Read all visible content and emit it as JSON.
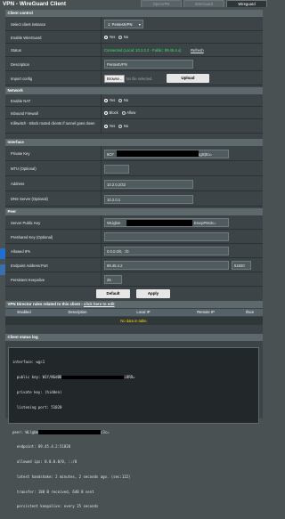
{
  "window": {
    "title": "VPN - WireGuard Client",
    "tabs": [
      "OpenVPN",
      "WireGuard",
      "Wireguard"
    ]
  },
  "sections": {
    "client_control": "Client control",
    "network": "Network",
    "interface": "Interface",
    "peer": "Peer",
    "director": "VPN Director rules related to this client - ",
    "director_link": "click here to edit",
    "status_log": "Client status log"
  },
  "client_control": {
    "instance_label": "Select client instance",
    "instance_value": "1: PentestVPN",
    "enable_label": "Enable WireGuard",
    "yes": "Yes",
    "no": "No",
    "status_label": "Status",
    "status_value": "Connected (Local: 10.2.0.2 - Public: 89.45.4.x)",
    "refresh": "Refresh",
    "desc_label": "Description",
    "desc_value": "PentestVPN",
    "import_label": "Import config",
    "browse": "Browse...",
    "no_file": "No file selected.",
    "upload": "Upload"
  },
  "network": {
    "nat_label": "Enable NAT",
    "firewall_label": "Inbound Firewall",
    "block": "Block",
    "allow": "Allow",
    "killswitch_label": "Killswitch - Block routed clients if tunnel goes down"
  },
  "interface": {
    "privkey_label": "Private Key",
    "privkey_prefix": "8CF",
    "privkey_suffix": "5gS|Eo=",
    "mtu_label": "MTU (Optional)",
    "mtu_value": "",
    "address_label": "Address",
    "address_value": "10.2.0.2/32",
    "dns_label": "DNS Server (Optional)",
    "dns_value": "10.2.0.1"
  },
  "peer": {
    "pubkey_label": "Server Public Key",
    "pubkey_prefix": "WLlgbm",
    "pubkey_suffix": "EIxcpP6s3c=",
    "psk_label": "Preshared Key (Optional)",
    "psk_value": "",
    "allowed_label": "Allowed IPs",
    "allowed_value": "0.0.0.0/0, ::/0",
    "endpoint_label": "Endpoint Address:Port",
    "endpoint_value": "89.45.4.2",
    "endpoint_port": "51820",
    "keepalive_label": "Persistent Keepalive",
    "keepalive_value": "25"
  },
  "buttons": {
    "default": "Default",
    "apply": "Apply"
  },
  "director_table": {
    "headers": [
      "Enabled",
      "Description",
      "Local IP",
      "Remote IP",
      "Iface"
    ],
    "no_data": "No data in table."
  },
  "log": [
    "interface: wgc1",
    "  public key: W1Y/NGdBB",
    "  private key: (hidden)",
    "  listening port: 51020",
    "",
    "peer: WLlgbm",
    "  endpoint: 89.45.4.2:51820",
    "  allowed ips: 0.0.0.0/0, ::/0",
    "  latest handshake: 2 minutes, 2 seconds ago. (sec:122)",
    "  transfer: 180 B received, 648 B sent",
    "  persistent keepalive: every 25 seconds"
  ],
  "log_suffix": {
    "pubkey_tail": "i8RR=",
    "peer_tail": "c3c="
  },
  "colors": {
    "status_green": "#3fe26c",
    "no_data_yellow": "#ffd800",
    "panel_bg": "#3c4447",
    "header_bg": "#5e696d"
  }
}
